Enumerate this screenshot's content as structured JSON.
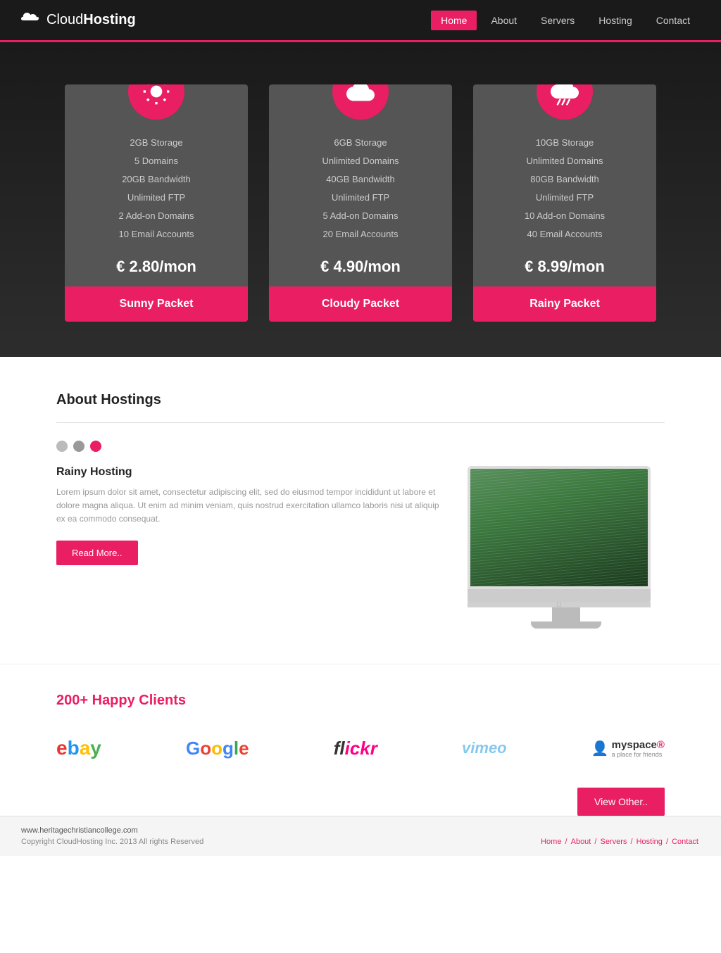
{
  "header": {
    "logo_text_light": "Cloud",
    "logo_text_bold": "Hosting",
    "nav": [
      {
        "label": "Home",
        "active": true
      },
      {
        "label": "About",
        "active": false
      },
      {
        "label": "Servers",
        "active": false
      },
      {
        "label": "Hosting",
        "active": false
      },
      {
        "label": "Contact",
        "active": false
      }
    ]
  },
  "pricing": {
    "cards": [
      {
        "id": "sunny",
        "icon": "sun",
        "features": [
          "2GB Storage",
          "5 Domains",
          "20GB Bandwidth",
          "Unlimited FTP",
          "2 Add-on Domains",
          "10 Email Accounts"
        ],
        "price": "€ 2.80/mon",
        "button": "Sunny Packet"
      },
      {
        "id": "cloudy",
        "icon": "cloud",
        "features": [
          "6GB Storage",
          "Unlimited Domains",
          "40GB Bandwidth",
          "Unlimited FTP",
          "5 Add-on Domains",
          "20 Email Accounts"
        ],
        "price": "€ 4.90/mon",
        "button": "Cloudy Packet"
      },
      {
        "id": "rainy",
        "icon": "rain",
        "features": [
          "10GB Storage",
          "Unlimited Domains",
          "80GB Bandwidth",
          "Unlimited FTP",
          "10 Add-on Domains",
          "40 Email Accounts"
        ],
        "price": "€ 8.99/mon",
        "button": "Rainy Packet"
      }
    ]
  },
  "about": {
    "title": "About Hostings",
    "subtitle": "Rainy Hosting",
    "description": "Lorem ipsum dolor sit amet, consectetur adipiscing elit, sed do eiusmod tempor incididunt ut labore et dolore magna aliqua. Ut enim ad minim veniam, quis nostrud exercitation ullamco laboris nisi ut aliquip ex ea commodo consequat.",
    "read_more_label": "Read More.."
  },
  "clients": {
    "title_highlight": "200+",
    "title_rest": " Happy Clients",
    "logos": [
      "ebay",
      "Google",
      "flickr",
      "vimeo",
      "myspace"
    ],
    "view_other_label": "View Other.."
  },
  "footer": {
    "url": "www.heritagechristiancollege.com",
    "copyright": "Copyright CloudHosting Inc. 2013  All rights Reserved",
    "breadcrumb": "Home / About / Servers / Hosting / Contact"
  }
}
